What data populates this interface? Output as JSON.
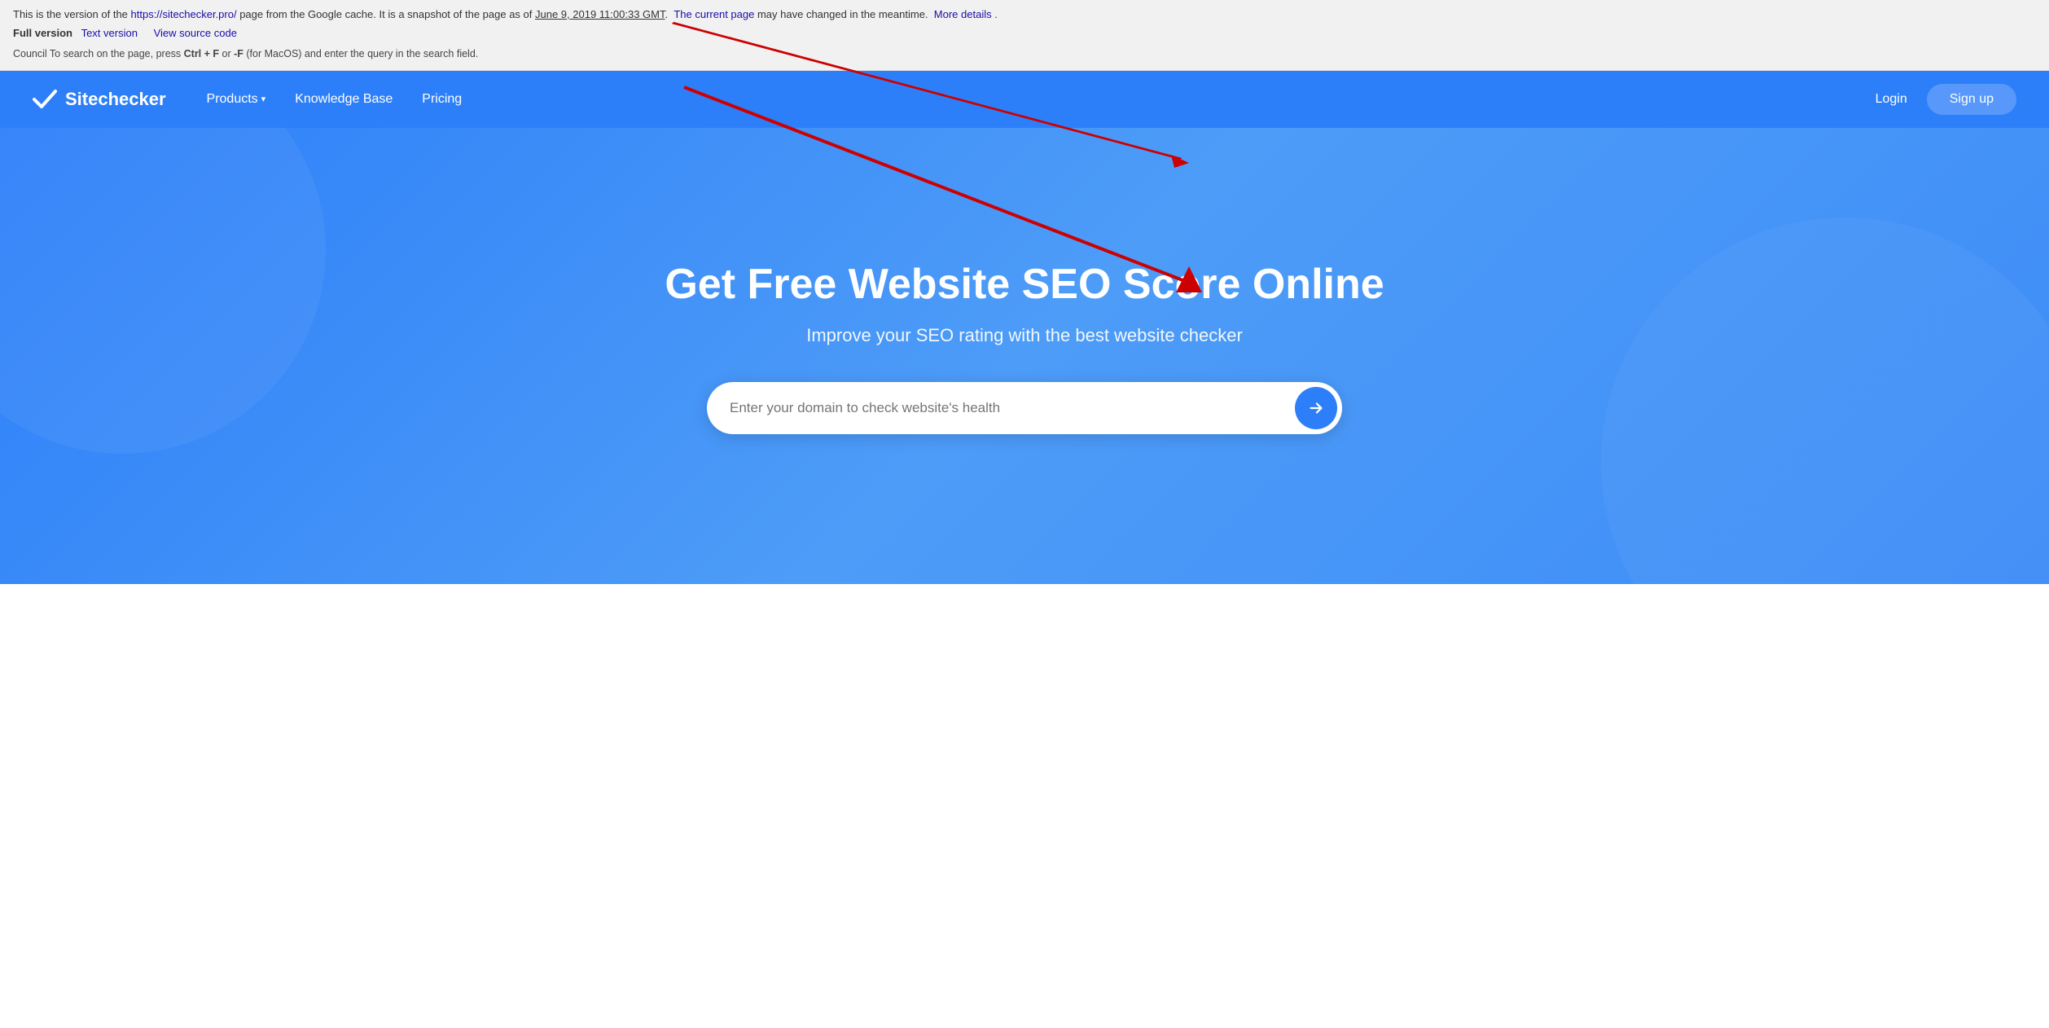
{
  "cache_banner": {
    "line1_prefix": "This is the version of the ",
    "site_url": "https://sitechecker.pro/",
    "line1_middle": " page from the Google cache.  It is a snapshot of the page as of ",
    "snapshot_date": "June 9, 2019 11:00:33 GMT",
    "line1_suffix": ".",
    "current_page_link": "The current page",
    "line1_end": " may have changed in the meantime.",
    "more_details": "More details",
    "full_version": "Full version",
    "text_version": "Text version",
    "view_source": "View source code",
    "tip": "Council To search on the page, press ",
    "shortcut1": "Ctrl + F",
    "or": " or ",
    "shortcut2": "-F",
    "tip_suffix": " (for MacOS) and enter the query in the search field."
  },
  "navbar": {
    "brand_name": "Sitechecker",
    "nav_items": [
      {
        "label": "Products",
        "has_dropdown": true
      },
      {
        "label": "Knowledge Base",
        "has_dropdown": false
      },
      {
        "label": "Pricing",
        "has_dropdown": false
      }
    ],
    "login_label": "Login",
    "signup_label": "Sign up"
  },
  "hero": {
    "title": "Get Free Website SEO Score Online",
    "subtitle": "Improve your SEO rating with the best website checker",
    "search_placeholder": "Enter your domain to check website's health"
  }
}
